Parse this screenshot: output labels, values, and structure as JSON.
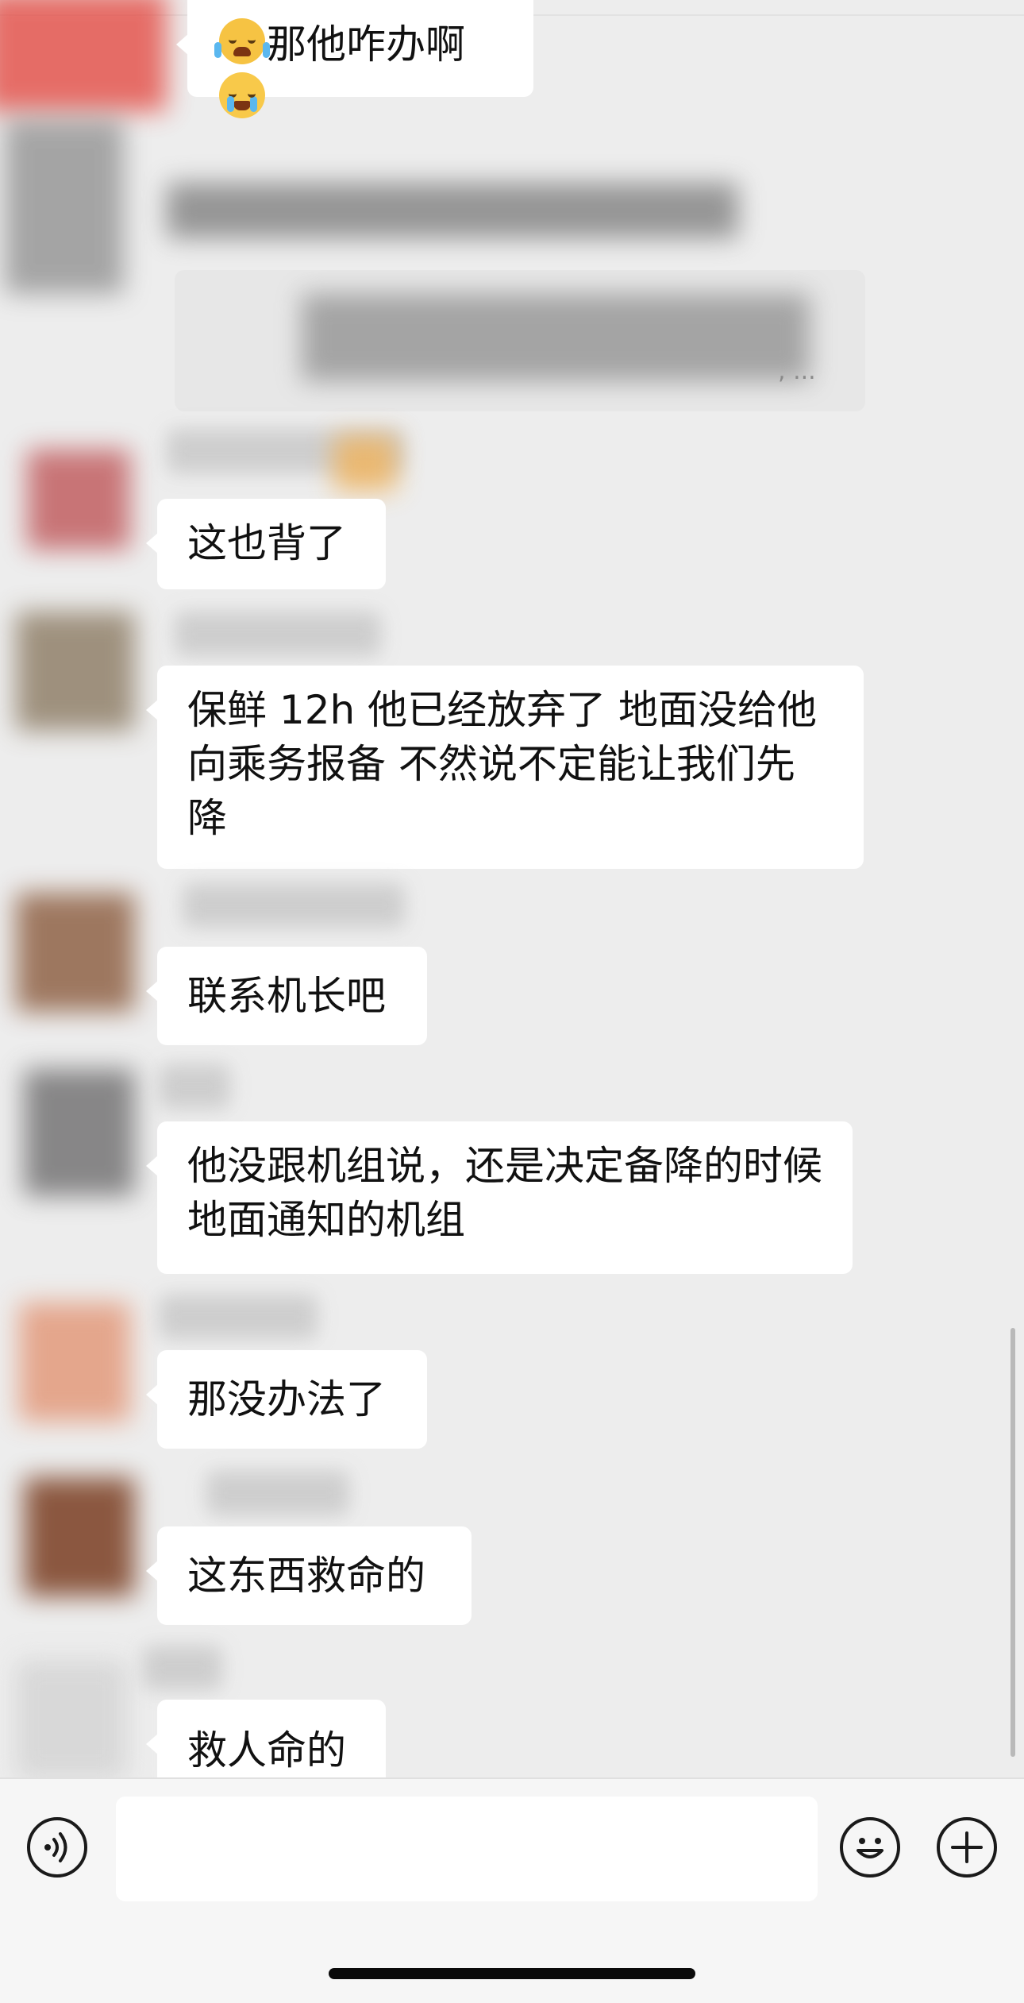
{
  "messages": [
    {
      "id": "m0",
      "text_before": "",
      "text": "那他咋办啊",
      "text_after": "",
      "emoji_before": "crying-laughing-emoji",
      "emoji_after": "crying-emoji"
    },
    {
      "id": "m1",
      "text": "这也背了"
    },
    {
      "id": "m2",
      "text": "保鲜 12h 他已经放弃了 地面没给他向乘务报备 不然说不定能让我们先降"
    },
    {
      "id": "m3",
      "text": "联系机长吧"
    },
    {
      "id": "m4",
      "text": "他没跟机组说，还是决定备降的时候地面通知的机组"
    },
    {
      "id": "m5",
      "text": "那没办法了"
    },
    {
      "id": "m6",
      "text": "这东西救命的"
    },
    {
      "id": "m7",
      "text": "救人命的"
    }
  ],
  "redacted_preview_suffix": ", ...",
  "input_bar": {
    "voice_icon": "voice-input-icon",
    "emoji_icon": "emoji-icon",
    "plus_icon": "plus-icon",
    "input_value": ""
  },
  "colors": {
    "background": "#ededed",
    "bubble": "#ffffff",
    "text": "#111111",
    "input_bar": "#f6f6f6"
  }
}
